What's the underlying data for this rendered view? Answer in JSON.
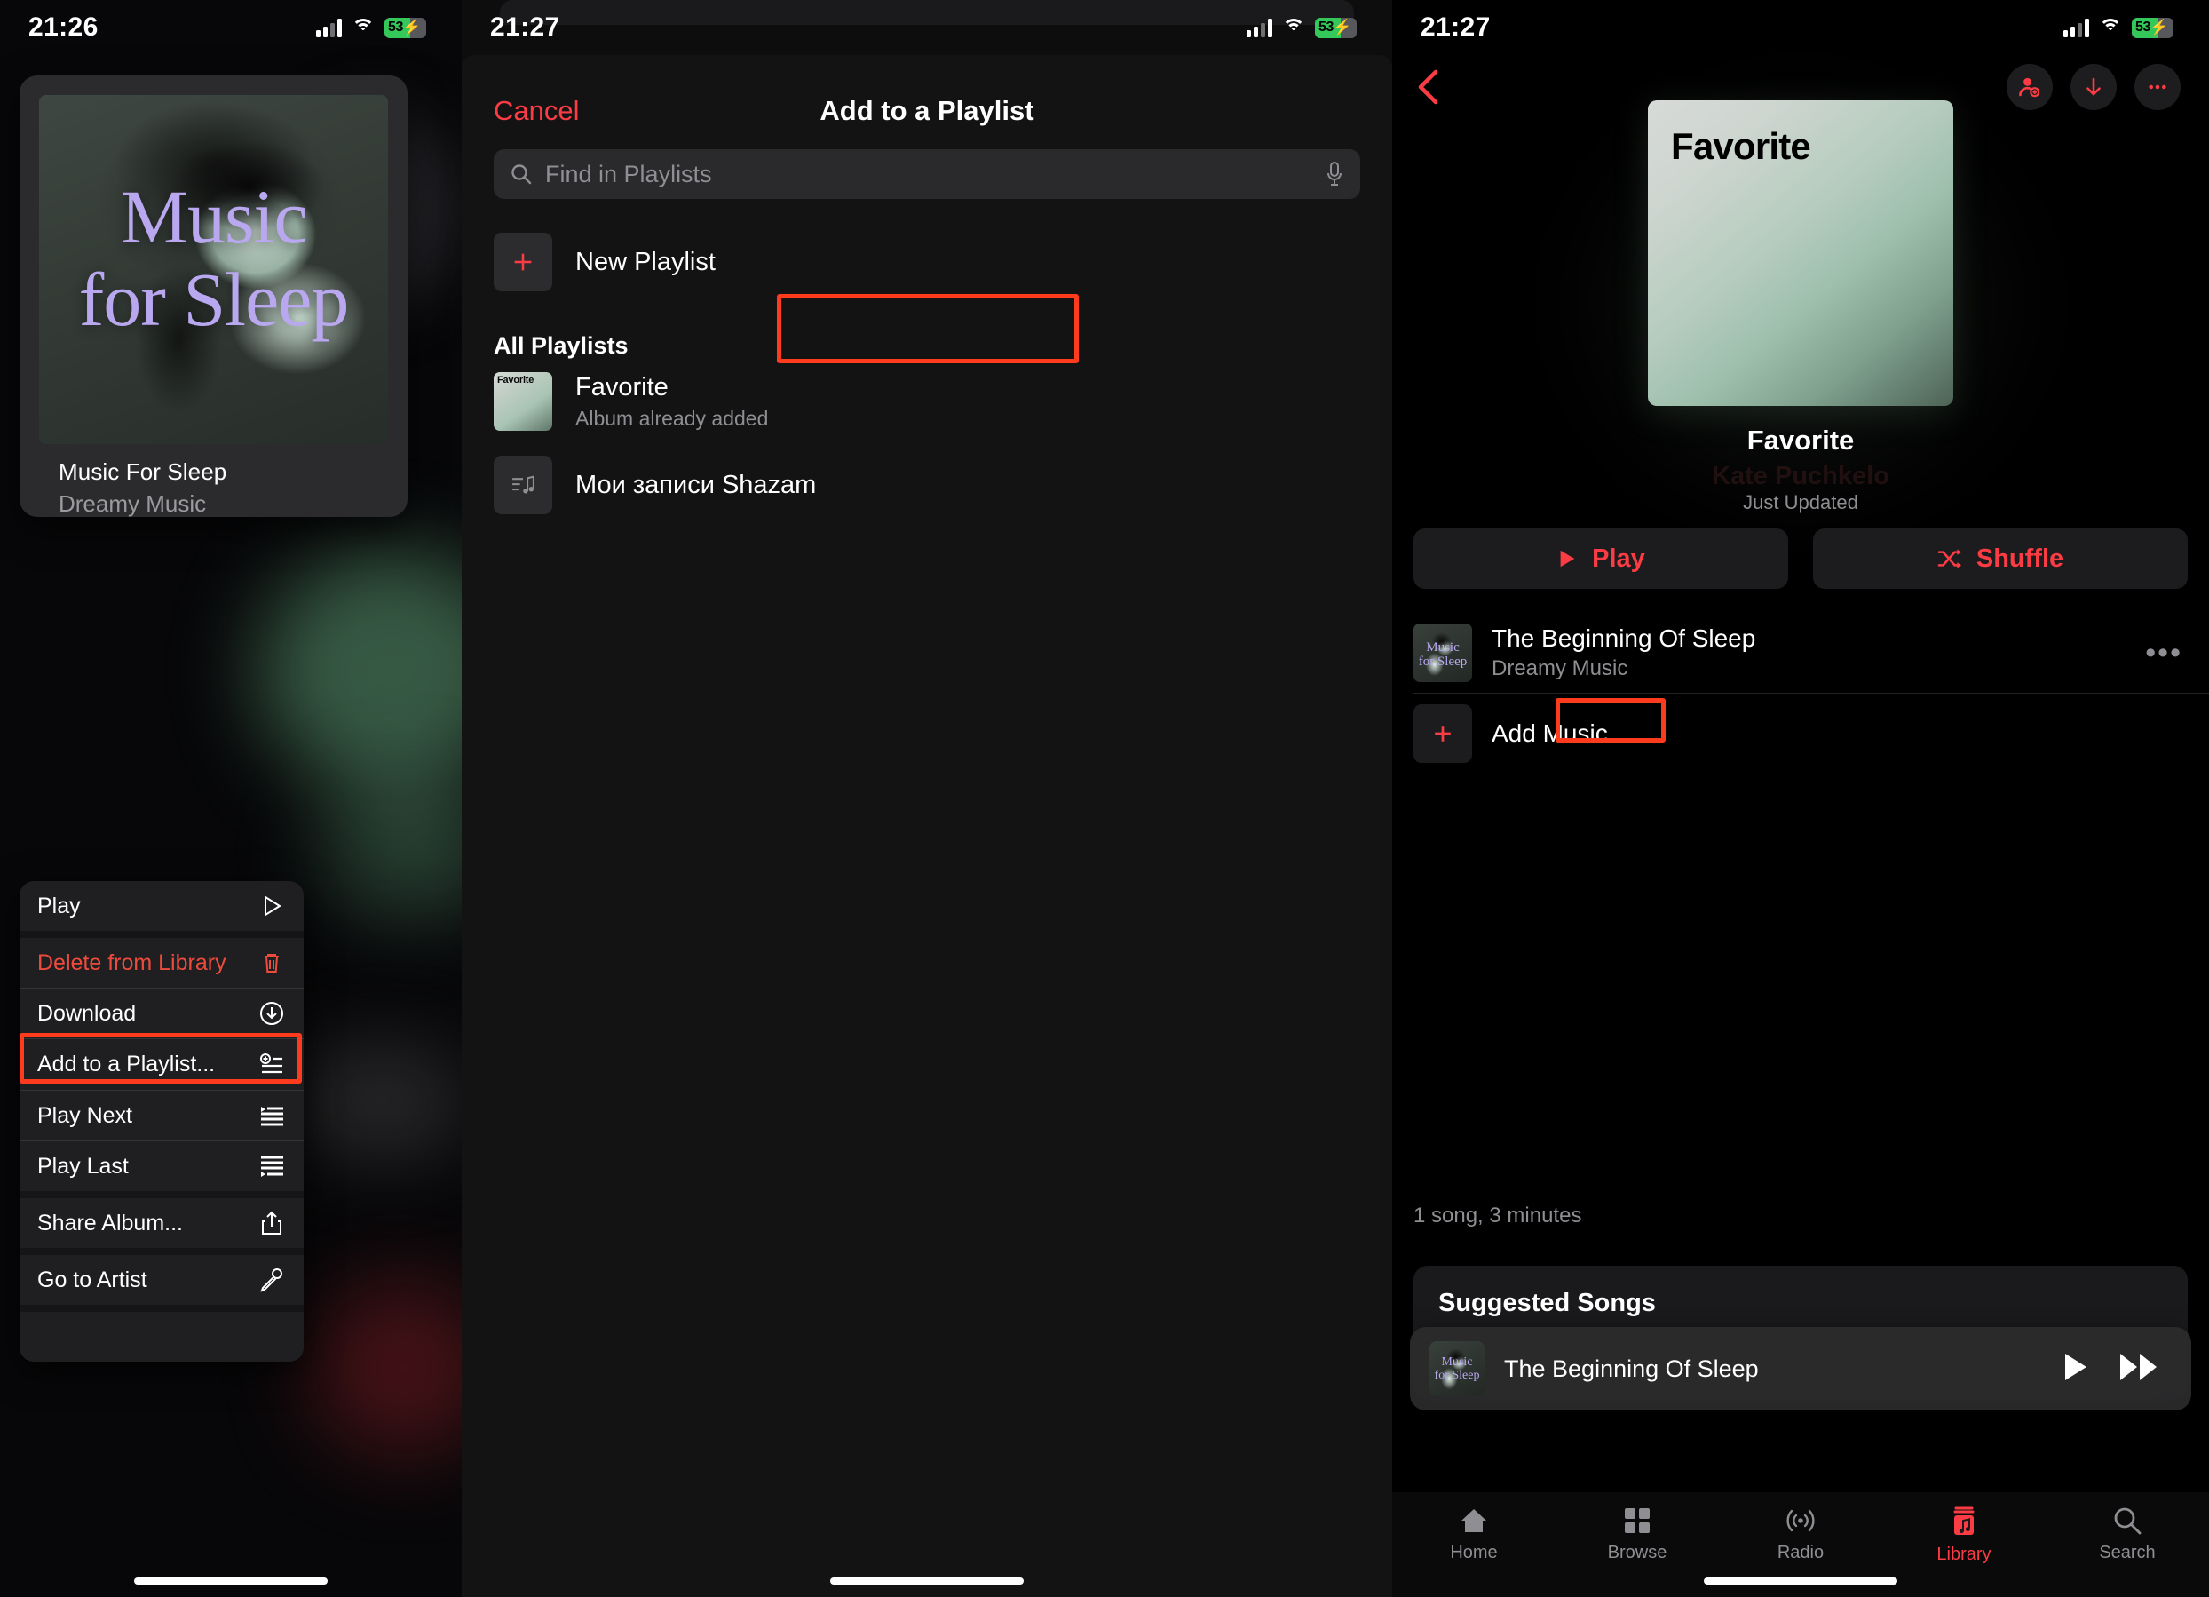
{
  "panel1": {
    "status": {
      "time": "21:26",
      "battery_pct": "53",
      "battery_bolt": "⚡",
      "icons": [
        "cellular-bars",
        "wifi",
        "battery"
      ]
    },
    "album": {
      "name": "Music For Sleep",
      "artist": "Dreamy Music",
      "art_line1": "Music",
      "art_line2": "for Sleep"
    },
    "context_menu": [
      {
        "label": "Play",
        "icon": "play-triangle-icon",
        "danger": false
      },
      {
        "label": "Delete from Library",
        "icon": "trash-icon",
        "danger": true
      },
      {
        "label": "Download",
        "icon": "download-circle-icon",
        "danger": false
      },
      {
        "label": "Add to a Playlist...",
        "icon": "add-to-playlist-icon",
        "danger": false
      },
      {
        "label": "Play Next",
        "icon": "play-next-icon",
        "danger": false
      },
      {
        "label": "Play Last",
        "icon": "play-last-icon",
        "danger": false
      },
      {
        "label": "Share Album...",
        "icon": "share-icon",
        "danger": false
      },
      {
        "label": "Go to Artist",
        "icon": "microphone-icon",
        "danger": false
      }
    ],
    "highlight": "Add to a Playlist..."
  },
  "panel2": {
    "status": {
      "time": "21:27",
      "battery_pct": "53",
      "battery_bolt": "⚡"
    },
    "sheet": {
      "cancel_label": "Cancel",
      "title": "Add to a Playlist",
      "search_placeholder": "Find in Playlists",
      "new_playlist_label": "New Playlist",
      "section_header": "All Playlists",
      "playlists": [
        {
          "name": "Favorite",
          "subtitle": "Album already added",
          "art_caption": "Favorite",
          "art_type": "gradient",
          "highlighted": true
        },
        {
          "name": "Мои записи Shazam",
          "subtitle": "",
          "art_caption": "",
          "art_type": "music-note-list-icon",
          "highlighted": false
        }
      ]
    }
  },
  "panel3": {
    "status": {
      "time": "21:27",
      "battery_pct": "53",
      "battery_bolt": "⚡"
    },
    "nav": {
      "back_icon": "chevron-left-icon",
      "actions": [
        "add-person-icon",
        "download-arrow-icon",
        "more-ellipsis-icon"
      ]
    },
    "playlist": {
      "cover_caption": "Favorite",
      "title": "Favorite",
      "author": "Kate Puchkelo",
      "updated": "Just Updated",
      "play_label": "Play",
      "shuffle_label": "Shuffle",
      "count_text": "1 song, 3 minutes",
      "suggested_header": "Suggested Songs"
    },
    "tracks": [
      {
        "title": "The Beginning Of Sleep",
        "artist": "Dreamy Music",
        "art_line1": "Music",
        "art_line2": "for Sleep",
        "more_icon": "more-ellipsis-icon"
      }
    ],
    "add_music_label": "Add Music",
    "mini_player": {
      "title": "The Beginning Of Sleep",
      "art_line1": "Music",
      "art_line2": "for Sleep",
      "play_icon": "play-icon",
      "next_icon": "fast-forward-icon"
    },
    "tabs": [
      {
        "label": "Home",
        "icon": "home-icon",
        "active": false
      },
      {
        "label": "Browse",
        "icon": "grid-icon",
        "active": false
      },
      {
        "label": "Radio",
        "icon": "radio-icon",
        "active": false
      },
      {
        "label": "Library",
        "icon": "library-icon",
        "active": true
      },
      {
        "label": "Search",
        "icon": "search-icon",
        "active": false
      }
    ],
    "highlight": "Favorite"
  },
  "colors": {
    "accent_red": "#fc3c44",
    "highlight_box": "#ff3b1e",
    "battery_green": "#34c759",
    "album_title_purple": "#b9a8ef"
  }
}
